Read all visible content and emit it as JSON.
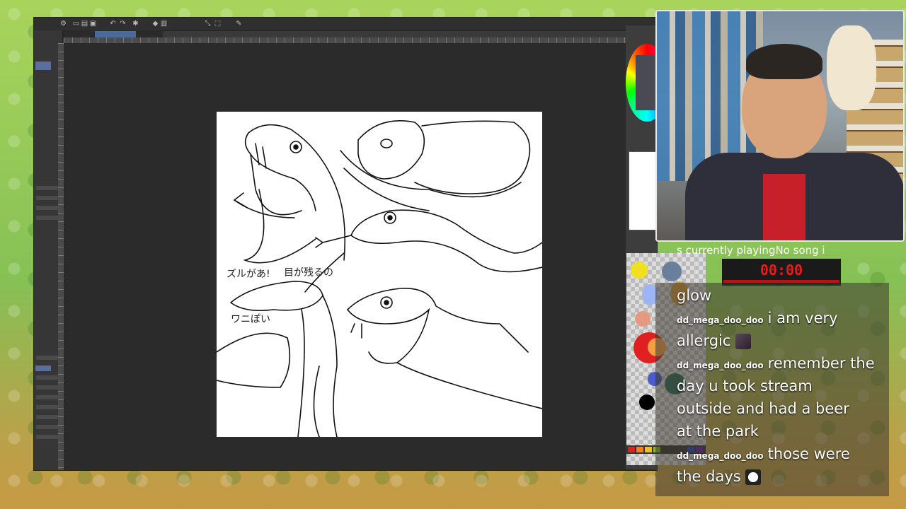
{
  "overlay": {
    "now_playing": "s currently playingNo song i",
    "timer": "00:00"
  },
  "chat": {
    "messages": [
      {
        "user": "",
        "text": "glow"
      },
      {
        "user": "dd_mega_doo_doo",
        "text": "i am very"
      },
      {
        "user": "",
        "text": "allergic",
        "emote": "face-emote"
      },
      {
        "user": "dd_mega_doo_doo",
        "text": "remember the"
      },
      {
        "user": "",
        "text": "day u took stream"
      },
      {
        "user": "",
        "text": "outside and had a beer"
      },
      {
        "user": "",
        "text": "at the park"
      },
      {
        "user": "dd_mega_doo_doo",
        "text": "those were"
      },
      {
        "user": "",
        "text": "the days",
        "emote": "sunglasses-emote"
      }
    ]
  },
  "canvas": {
    "caption_left": "ズルがあ!",
    "caption_mid": "目が残るの",
    "caption_small": "ワニぽい"
  },
  "colors": {
    "timer_red": "#e81a1a",
    "chat_text": "#ffffff"
  }
}
